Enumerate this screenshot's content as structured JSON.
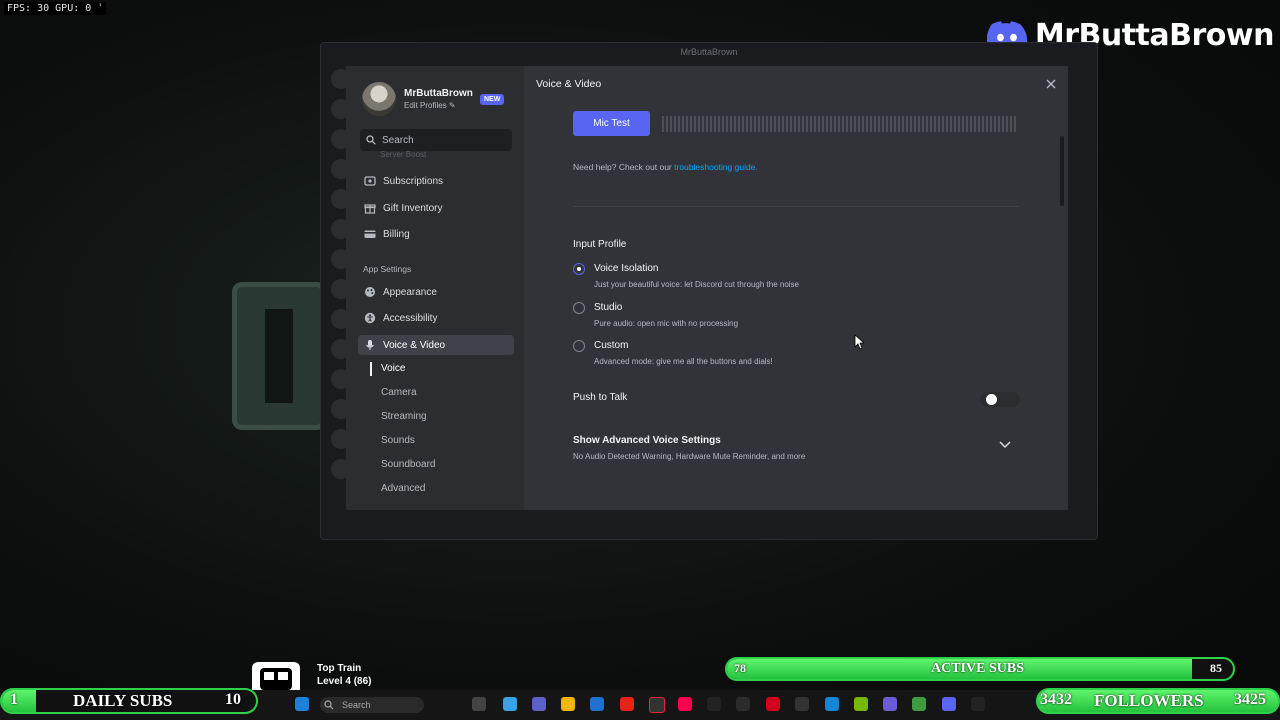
{
  "overlay": {
    "fps_readout": "FPS:  30  GPU: 0 ˈ",
    "channel_name": "MrButtaBrown",
    "top_train": "Top Train",
    "train_level": "Level 4 (86)",
    "active_subs": {
      "label": "ACTIVE SUBS",
      "current": "78",
      "goal": "85",
      "progress": 0.918
    },
    "daily_subs": {
      "label": "DAILY SUBS",
      "current": "1",
      "goal": "10",
      "progress": 0.1
    },
    "followers": {
      "label": "FOLLOWERS",
      "current": "3432",
      "goal": "3425"
    }
  },
  "window": {
    "title": "MrButtaBrown"
  },
  "profile": {
    "name": "MrButtaBrown",
    "edit": "Edit Profiles ✎",
    "badge": "NEW"
  },
  "search": {
    "placeholder": "Search"
  },
  "sidebar": {
    "faded_item": "Server Boost",
    "items": [
      {
        "label": "Subscriptions",
        "icon": "subscriptions-icon"
      },
      {
        "label": "Gift Inventory",
        "icon": "gift-icon"
      },
      {
        "label": "Billing",
        "icon": "billing-card-icon"
      }
    ],
    "app_settings_header": "App Settings",
    "app_items": [
      {
        "label": "Appearance",
        "icon": "palette-icon"
      },
      {
        "label": "Accessibility",
        "icon": "accessibility-icon"
      },
      {
        "label": "Voice & Video",
        "icon": "microphone-icon"
      }
    ],
    "sub_items": [
      "Voice",
      "Camera",
      "Streaming",
      "Sounds",
      "Soundboard",
      "Advanced"
    ]
  },
  "content": {
    "title": "Voice & Video",
    "mic_test_label": "Mic Test",
    "help_prefix": "Need help? Check out our ",
    "help_link": "troubleshooting guide.",
    "input_profile_title": "Input Profile",
    "options": [
      {
        "label": "Voice Isolation",
        "desc": "Just your beautiful voice: let Discord cut through the noise",
        "selected": true
      },
      {
        "label": "Studio",
        "desc": "Pure audio: open mic with no processing",
        "selected": false
      },
      {
        "label": "Custom",
        "desc": "Advanced mode: give me all the buttons and dials!",
        "selected": false
      }
    ],
    "push_to_talk": "Push to Talk",
    "push_to_talk_enabled": false,
    "advanced_title": "Show Advanced Voice Settings",
    "advanced_desc": "No Audio Detected Warning, Hardware Mute Reminder, and more"
  },
  "taskbar": {
    "search": "Search"
  },
  "colors": {
    "accent": "#5865f2",
    "link": "#00a8fc",
    "subs_green": "#2ed14a"
  }
}
